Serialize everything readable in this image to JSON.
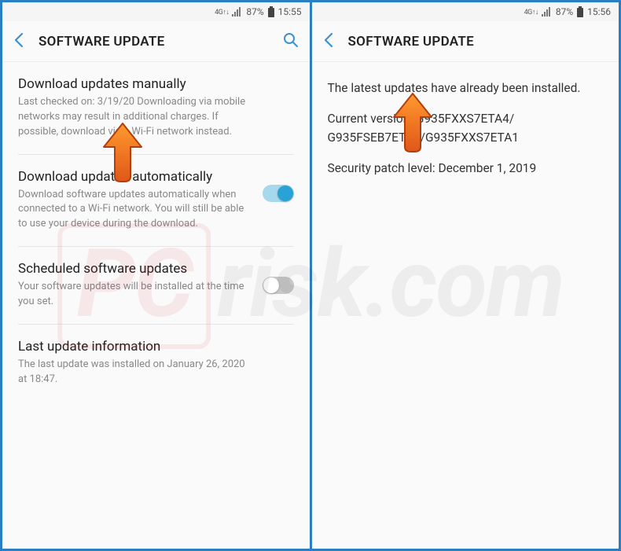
{
  "left": {
    "status": {
      "net": "4G",
      "battery": "87%",
      "time": "15:55"
    },
    "header": {
      "title": "SOFTWARE UPDATE"
    },
    "sections": {
      "manual": {
        "title": "Download updates manually",
        "sub": "Last checked on: 3/19/20\nDownloading via mobile networks may result in additional charges. If possible, download via a Wi-Fi network instead."
      },
      "auto": {
        "title": "Download updates automatically",
        "sub": "Download software updates automatically when connected to a Wi-Fi network. You will still be able to use your device during the download.",
        "toggle": true
      },
      "scheduled": {
        "title": "Scheduled software updates",
        "sub": "Your software updates will be installed at the time you set.",
        "toggle": false
      },
      "last": {
        "title": "Last update information",
        "sub": "The last update was installed on January 26, 2020 at 18:47."
      }
    }
  },
  "right": {
    "status": {
      "net": "4G",
      "battery": "87%",
      "time": "15:56"
    },
    "header": {
      "title": "SOFTWARE UPDATE"
    },
    "info": {
      "line1": "The latest updates have already been installed.",
      "line2a": "Current version: G935FXXS7ETA4/",
      "line2b": "G935FSEB7ETA1/G935FXXS7ETA1",
      "line3": "Security patch level: December 1, 2019"
    }
  },
  "watermark": {
    "accent": "PC",
    "rest": "risk.com"
  }
}
